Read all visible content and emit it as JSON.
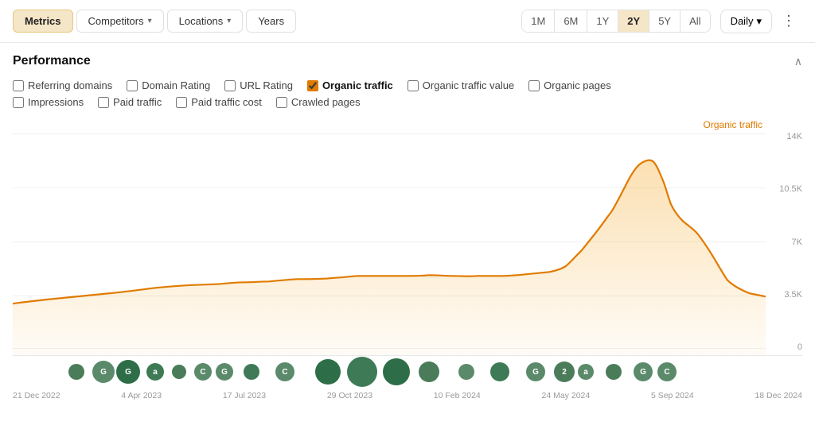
{
  "nav": {
    "tabs": [
      {
        "label": "Metrics",
        "active": true
      },
      {
        "label": "Competitors",
        "hasDropdown": true
      },
      {
        "label": "Locations",
        "hasDropdown": true
      },
      {
        "label": "Years",
        "hasDropdown": false
      }
    ],
    "timeRanges": [
      {
        "label": "1M",
        "active": false
      },
      {
        "label": "6M",
        "active": false
      },
      {
        "label": "1Y",
        "active": false
      },
      {
        "label": "2Y",
        "active": true
      },
      {
        "label": "5Y",
        "active": false
      },
      {
        "label": "All",
        "active": false
      }
    ],
    "granularity": {
      "label": "Daily",
      "hasDropdown": true
    },
    "more_icon": "⋮"
  },
  "performance": {
    "title": "Performance",
    "metrics_row1": [
      {
        "label": "Referring domains",
        "checked": false
      },
      {
        "label": "Domain Rating",
        "checked": false
      },
      {
        "label": "URL Rating",
        "checked": false
      },
      {
        "label": "Organic traffic",
        "checked": true
      },
      {
        "label": "Organic traffic value",
        "checked": false
      },
      {
        "label": "Organic pages",
        "checked": false
      }
    ],
    "metrics_row2": [
      {
        "label": "Impressions",
        "checked": false
      },
      {
        "label": "Paid traffic",
        "checked": false
      },
      {
        "label": "Paid traffic cost",
        "checked": false
      },
      {
        "label": "Crawled pages",
        "checked": false
      }
    ],
    "chart": {
      "series_label": "Organic traffic",
      "y_labels": [
        "14K",
        "10.5K",
        "7K",
        "3.5K",
        "0"
      ],
      "x_labels": [
        "21 Dec 2022",
        "4 Apr 2023",
        "17 Jul 2023",
        "29 Oct 2023",
        "10 Feb 2024",
        "24 May 2024",
        "5 Sep 2024",
        "18 Dec 2024"
      ]
    }
  }
}
